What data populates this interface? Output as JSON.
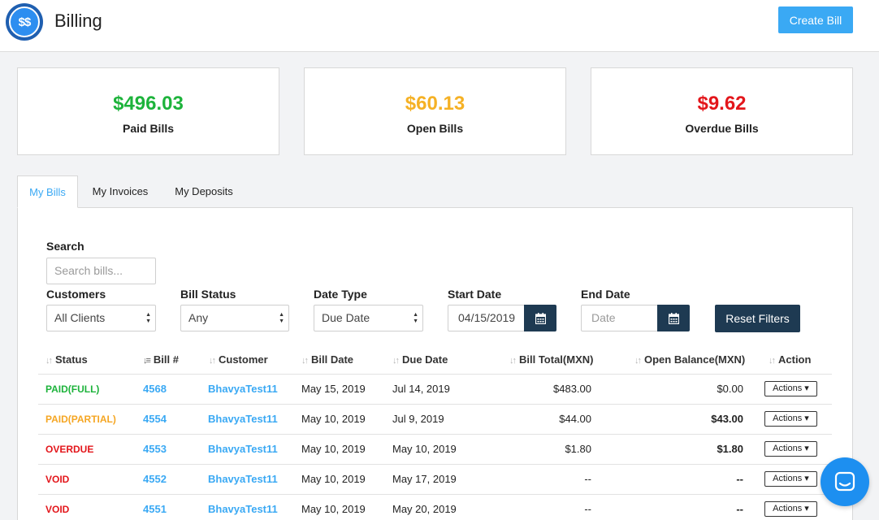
{
  "header": {
    "title": "Billing",
    "logo_text": "$$",
    "create_button": "Create Bill"
  },
  "cards": [
    {
      "amount": "$496.03",
      "label": "Paid Bills",
      "color": "#1db33b"
    },
    {
      "amount": "$60.13",
      "label": "Open Bills",
      "color": "#f5b125"
    },
    {
      "amount": "$9.62",
      "label": "Overdue Bills",
      "color": "#e3161b"
    }
  ],
  "tabs": [
    {
      "label": "My Bills",
      "active": true
    },
    {
      "label": "My Invoices",
      "active": false
    },
    {
      "label": "My Deposits",
      "active": false
    }
  ],
  "filters": {
    "search_label": "Search",
    "search_placeholder": "Search bills...",
    "customers_label": "Customers",
    "customers_value": "All Clients",
    "status_label": "Bill Status",
    "status_value": "Any",
    "date_type_label": "Date Type",
    "date_type_value": "Due Date",
    "start_label": "Start Date",
    "start_value": "04/15/2019",
    "end_label": "End Date",
    "end_placeholder": "Date",
    "reset_button": "Reset Filters"
  },
  "table": {
    "headers": {
      "status": "Status",
      "bill_no": "Bill #",
      "customer": "Customer",
      "bill_date": "Bill Date",
      "due_date": "Due Date",
      "total": "Bill Total(MXN)",
      "balance": "Open Balance(MXN)",
      "action": "Action"
    },
    "action_label": "Actions",
    "rows": [
      {
        "status": "PAID(FULL)",
        "status_color": "#1db33b",
        "bill_no": "4568",
        "customer": "BhavyaTest11",
        "bill_date": "May 15, 2019",
        "due_date": "Jul 14, 2019",
        "total": "$483.00",
        "balance": "$0.00",
        "balance_bold": false
      },
      {
        "status": "PAID(PARTIAL)",
        "status_color": "#f5a623",
        "bill_no": "4554",
        "customer": "BhavyaTest11",
        "bill_date": "May 10, 2019",
        "due_date": "Jul 9, 2019",
        "total": "$44.00",
        "balance": "$43.00",
        "balance_bold": true
      },
      {
        "status": "OVERDUE",
        "status_color": "#e3161b",
        "bill_no": "4553",
        "customer": "BhavyaTest11",
        "bill_date": "May 10, 2019",
        "due_date": "May 10, 2019",
        "total": "$1.80",
        "balance": "$1.80",
        "balance_bold": true
      },
      {
        "status": "VOID",
        "status_color": "#e3161b",
        "bill_no": "4552",
        "customer": "BhavyaTest11",
        "bill_date": "May 10, 2019",
        "due_date": "May 17, 2019",
        "total": "--",
        "balance": "--",
        "balance_bold": true
      },
      {
        "status": "VOID",
        "status_color": "#e3161b",
        "bill_no": "4551",
        "customer": "BhavyaTest11",
        "bill_date": "May 10, 2019",
        "due_date": "May 20, 2019",
        "total": "--",
        "balance": "--",
        "balance_bold": true
      }
    ]
  }
}
